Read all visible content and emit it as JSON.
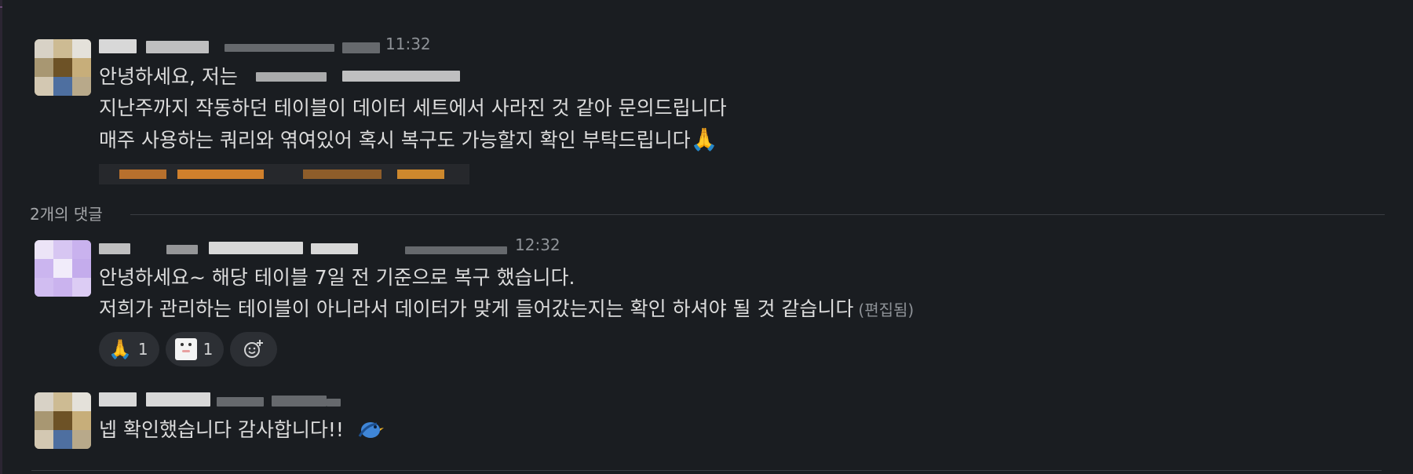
{
  "thread": {
    "parent": {
      "lines": [
        "안녕하세요, 저는",
        "지난주까지 작동하던 테이블이 데이터 세트에서 사라진 것 같아 문의드립니다",
        "매주 사용하는 쿼리와 엮여있어 혹시 복구도 가능할지 확인 부탁드립니다"
      ],
      "emoji": "🙏",
      "time_fragment": "11:32"
    },
    "reply_count_label": "2개의 댓글",
    "replies": [
      {
        "lines": [
          "안녕하세요~ 해당 테이블 7일 전 기준으로 복구 했습니다.",
          "저희가 관리하는 테이블이 아니라서 데이터가 맞게 들어갔는지는 확인 하셔야 될 것 같습니다"
        ],
        "edited_label": "(편집됨)",
        "time_fragment": "12:32",
        "reactions": [
          {
            "icon": "pray-emoji-icon",
            "count": "1"
          },
          {
            "icon": "character-emoji-icon",
            "count": "1"
          }
        ]
      },
      {
        "lines": [
          "넵 확인했습니다 감사합니다!!"
        ],
        "emoji_icon": "blue-bird-emoji-icon"
      }
    ]
  },
  "colors": {
    "background": "#1a1d21",
    "text": "#dcdcdc",
    "muted": "#8e9297",
    "reaction_bg": "#2c2f34",
    "divider": "#3a3d42"
  }
}
